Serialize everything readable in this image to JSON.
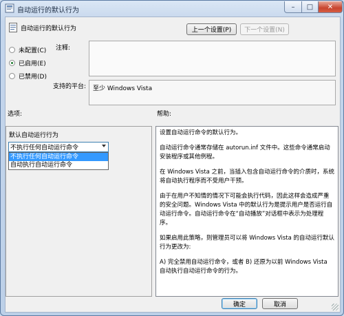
{
  "window": {
    "title": "自动运行的默认行为",
    "min_symbol": "–",
    "max_symbol": "□",
    "close_symbol": "✕"
  },
  "header": {
    "setting_name": "自动运行的默认行为"
  },
  "nav": {
    "prev_label": "上一个设置(P)",
    "next_label": "下一个设置(N)"
  },
  "state": {
    "options": [
      {
        "label": "未配置(C)",
        "selected": false
      },
      {
        "label": "已启用(E)",
        "selected": true
      },
      {
        "label": "已禁用(D)",
        "selected": false
      }
    ]
  },
  "comment": {
    "label": "注释:",
    "value": ""
  },
  "platform": {
    "label": "支持的平台:",
    "value": "至少 Windows Vista"
  },
  "options_panel": {
    "label": "选项:",
    "field_label": "默认自动运行行为",
    "combo_value": "不执行任何自动运行命令",
    "dropdown_items": [
      "不执行任何自动运行命令",
      "自动执行自动运行命令"
    ]
  },
  "help": {
    "label": "帮助:",
    "paragraphs": [
      "设置自动运行命令的默认行为。",
      "自动运行命令通常存储在 autorun.inf 文件中。这些命令通常启动安装程序或其他例程。",
      "在 Windows Vista 之前，当插入包含自动运行命令的介质时，系统将自动执行程序而不受用户干预。",
      "由于在用户不知情的情况下可能会执行代码，因此这样会造成严重的安全问题。Windows Vista 中的默认行为是提示用户是否运行自动运行命令。自动运行命令在“自动播放”对话框中表示为处理程序。",
      "如果启用此策略，则管理员可以将 Windows Vista 的自动运行默认行为更改为:",
      "A) 完全禁用自动运行命令，或者 B) 还原为以前 Windows Vista 自动执行自动运行命令的行为。"
    ]
  },
  "footer": {
    "ok_label": "确定",
    "cancel_label": "取消"
  }
}
